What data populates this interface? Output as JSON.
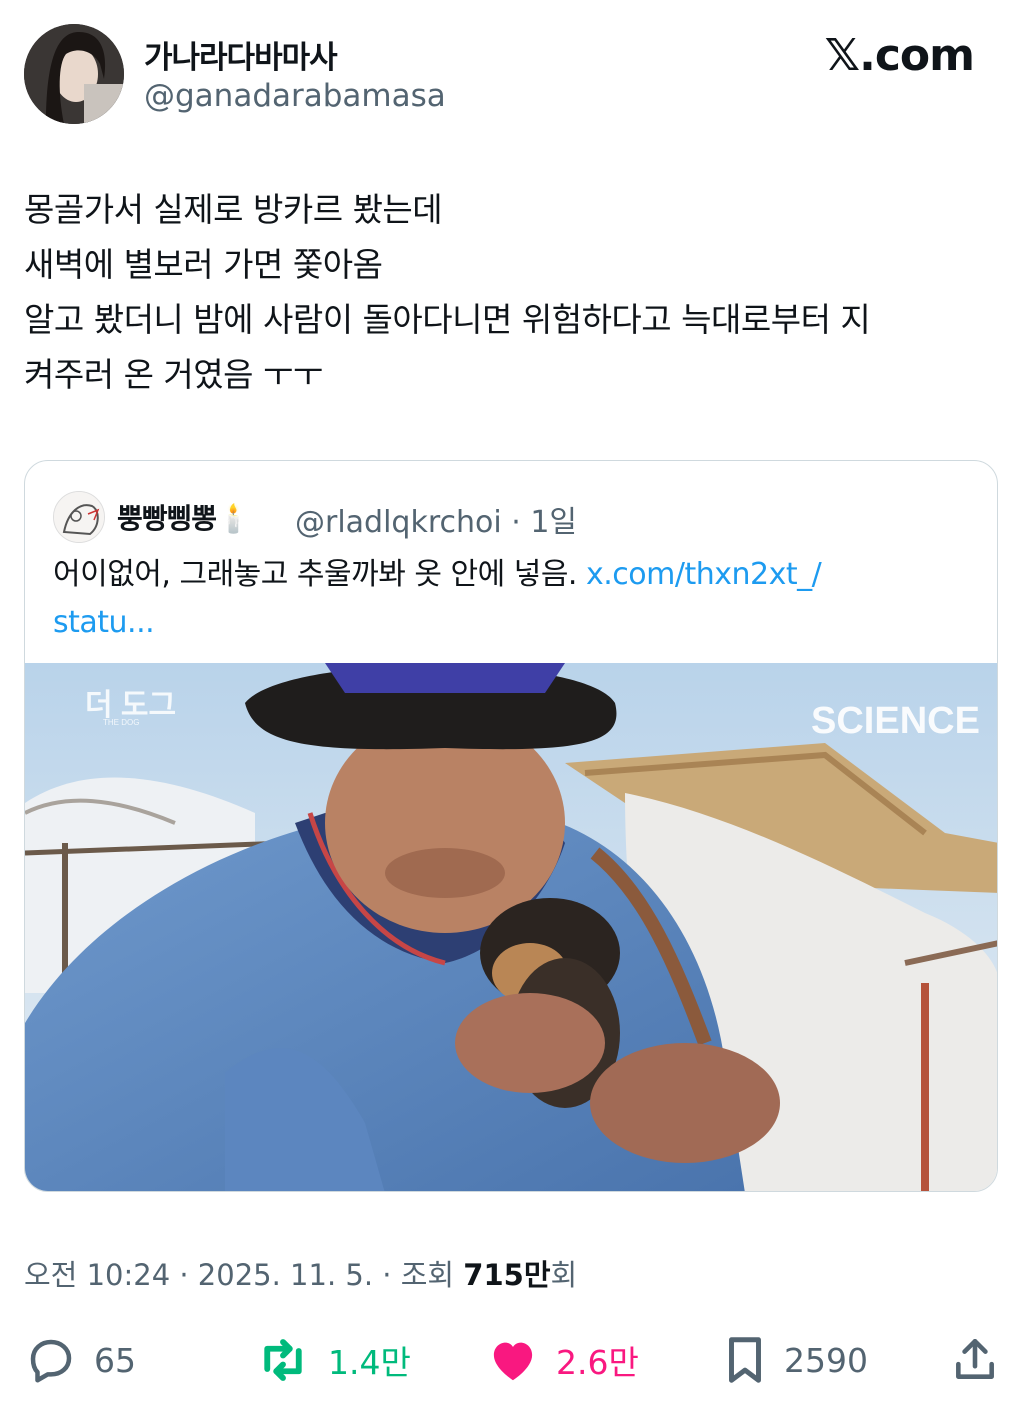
{
  "author": {
    "display_name": "가나라다바마사",
    "handle": "@ganadarabamasa"
  },
  "brand": "𝕏.com",
  "tweet_lines": [
    "몽골가서 실제로 방카르 봤는데",
    "새벽에 별보러 가면 쫓아옴",
    "알고 봤더니 밤에 사람이 돌아다니면 위험하다고 늑대로부터 지",
    "켜주러 온 거였음 ㅜㅜ"
  ],
  "quote": {
    "display_name": "뿡빵삥뽕🕯️",
    "handle_time": "@rladlqkrchoi · 1일",
    "text": "어이없어, 그래놓고 추울까봐 옷 안에 넣음. ",
    "link_part1": "x.com/thxn2xt_/",
    "link_part2": "statu...",
    "media_watermark_left": "더 도그",
    "media_watermark_sub": "THE DOG",
    "media_watermark_right": "SCIENCE"
  },
  "meta": {
    "prefix": "오전 10:24 · 2025. 11. 5. · 조회 ",
    "views": "715만",
    "suffix": "회"
  },
  "actions": {
    "reply_count": "65",
    "retweet_count": "1.4만",
    "like_count": "2.6만",
    "bookmark_count": "2590"
  },
  "colors": {
    "retweet": "#00ba7c",
    "like": "#f91880",
    "link": "#1d9bf0",
    "secondary_text": "#536471"
  }
}
